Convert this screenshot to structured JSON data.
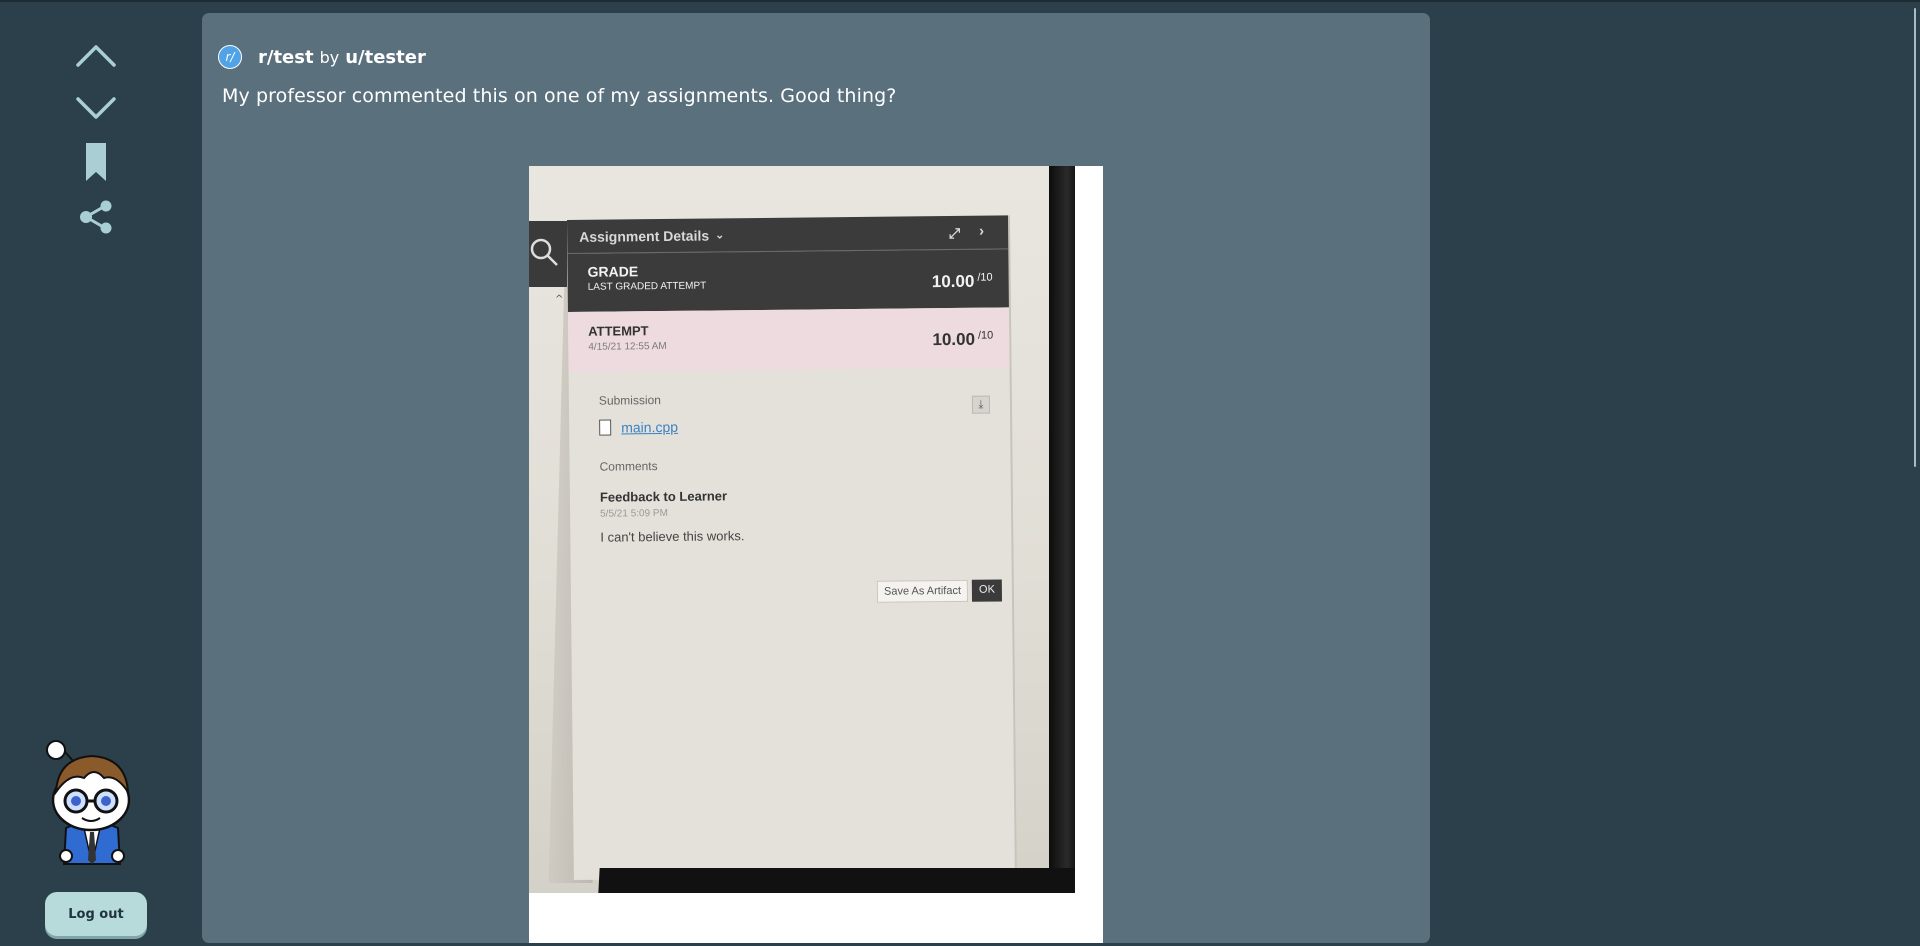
{
  "colors": {
    "page_background": "#2c404b",
    "card_background": "#5a707c",
    "accent_subreddit": "#4fa3e6",
    "logout_button": "#b7dada"
  },
  "rail": {
    "upvote_icon": "chevron-up-icon",
    "downvote_icon": "chevron-down-icon",
    "save_icon": "bookmark-icon",
    "share_icon": "share-icon",
    "logout_label": "Log out"
  },
  "post": {
    "subreddit_icon_text": "r/",
    "subreddit": "r/test",
    "by_label": "by",
    "author": "u/tester",
    "title": "My professor commented this on one of my assignments. Good thing?"
  },
  "photo": {
    "header": "Assignment Details",
    "grade_label": "GRADE",
    "grade_sub": "LAST GRADED ATTEMPT",
    "grade_score": "10.00",
    "grade_denominator": "/10",
    "attempt_label": "ATTEMPT",
    "attempt_date": "4/15/21 12:55 AM",
    "attempt_score": "10.00",
    "attempt_denominator": "/10",
    "submission_label": "Submission",
    "file_name": "main.cpp",
    "comments_label": "Comments",
    "feedback_title": "Feedback to Learner",
    "feedback_date": "5/5/21 5:09 PM",
    "feedback_text": "I can't believe this works.",
    "save_artifact": "Save As Artifact",
    "ok": "OK"
  }
}
